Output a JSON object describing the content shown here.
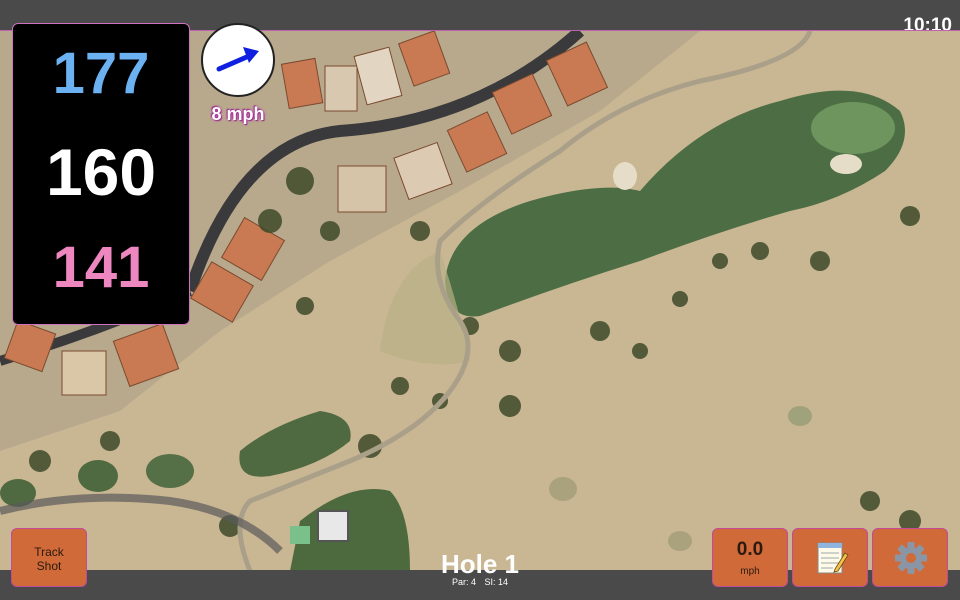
{
  "status": {
    "time": "10:10"
  },
  "yardage": {
    "back": "177",
    "center": "160",
    "front": "141"
  },
  "wind": {
    "speed_label": "8 mph",
    "icon": "wind-arrow-icon"
  },
  "buttons": {
    "track_shot_line1": "Track",
    "track_shot_line2": "Shot",
    "speed_value": "0.0",
    "speed_unit": "mph",
    "notes_icon": "notepad-icon",
    "settings_icon": "gear-icon"
  },
  "hole": {
    "title": "Hole 1",
    "par": "Par: 4",
    "si": "SI: 14"
  },
  "colors": {
    "back_yardage": "#6cb2f2",
    "center_yardage": "#ffffff",
    "front_yardage": "#ee86c0",
    "button_bg": "#d06a38",
    "wind_arrow": "#1020e0"
  }
}
